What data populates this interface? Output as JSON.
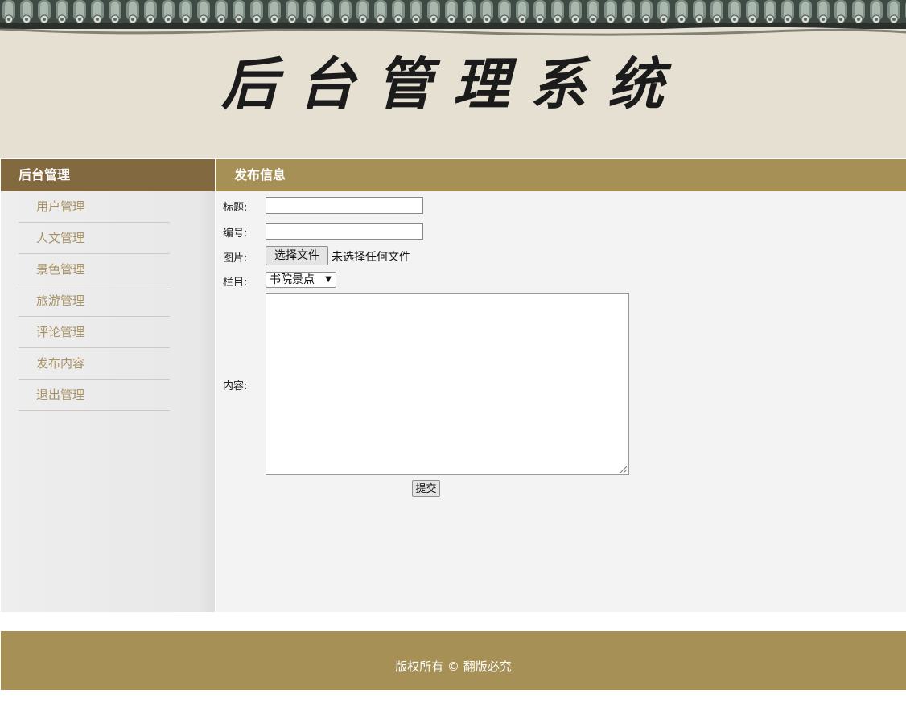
{
  "header": {
    "title": "后台管理系统"
  },
  "sidebar": {
    "heading": "后台管理",
    "items": [
      {
        "label": "用户管理"
      },
      {
        "label": "人文管理"
      },
      {
        "label": "景色管理"
      },
      {
        "label": "旅游管理"
      },
      {
        "label": "评论管理"
      },
      {
        "label": "发布内容"
      },
      {
        "label": "退出管理"
      }
    ]
  },
  "main": {
    "heading": "发布信息",
    "form": {
      "title_label": "标题:",
      "title_value": "",
      "number_label": "编号:",
      "number_value": "",
      "image_label": "图片:",
      "file_button": "选择文件",
      "file_status": "未选择任何文件",
      "column_label": "栏目:",
      "column_selected": "书院景点",
      "content_label": "内容:",
      "content_value": "",
      "submit_label": "提交"
    }
  },
  "footer": {
    "text": "版权所有 © 翻版必究"
  },
  "colors": {
    "sidebar_head": "#83693f",
    "accent": "#a69055",
    "menu_text": "#a89264",
    "header_bg": "#e6e0d3"
  }
}
